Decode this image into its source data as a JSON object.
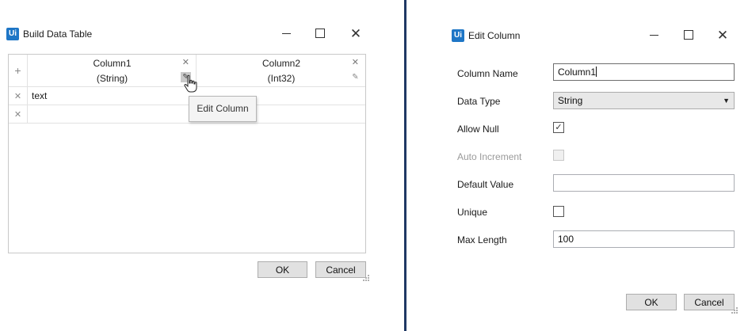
{
  "build_window": {
    "logo": "Ui",
    "title": "Build Data Table",
    "columns": [
      {
        "name": "Column1",
        "type": "(String)"
      },
      {
        "name": "Column2",
        "type": "(Int32)"
      }
    ],
    "rows": [
      {
        "cells": [
          "text",
          ""
        ]
      },
      {
        "cells": [
          "",
          ""
        ]
      }
    ],
    "tooltip": "Edit Column",
    "ok_label": "OK",
    "cancel_label": "Cancel"
  },
  "edit_window": {
    "logo": "Ui",
    "title": "Edit Column",
    "fields": {
      "column_name": {
        "label": "Column Name",
        "value": "Column1"
      },
      "data_type": {
        "label": "Data Type",
        "value": "String"
      },
      "allow_null": {
        "label": "Allow Null",
        "checked": true
      },
      "auto_increment": {
        "label": "Auto Increment",
        "checked": false,
        "disabled": true
      },
      "default_value": {
        "label": "Default Value",
        "value": ""
      },
      "unique": {
        "label": "Unique",
        "checked": false
      },
      "max_length": {
        "label": "Max Length",
        "value": "100"
      }
    },
    "ok_label": "OK",
    "cancel_label": "Cancel"
  },
  "icons": {
    "add": "plus-icon",
    "delete": "close-icon",
    "edit": "pencil-icon",
    "check": "checkmark-icon",
    "dropdown": "caret-down-icon"
  },
  "colors": {
    "logo_bg": "#1e76c6",
    "divider": "#1f3864",
    "button_bg": "#e1e1e1"
  }
}
